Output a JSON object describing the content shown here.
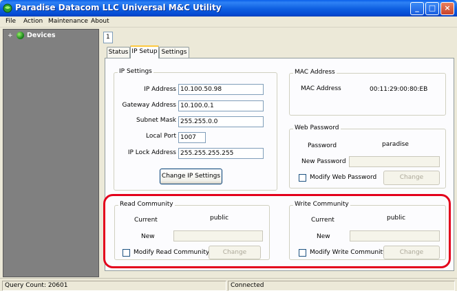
{
  "window": {
    "title": "Paradise Datacom LLC Universal M&C Utility",
    "minimize": "_",
    "maximize": "□",
    "close": "×"
  },
  "menu": [
    "File",
    "Action",
    "Maintenance",
    "About"
  ],
  "tree": {
    "expander": "+",
    "label": "Devices"
  },
  "device_tab": "1",
  "tabs": [
    "Status",
    "IP Setup",
    "Settings"
  ],
  "active_tab": "IP Setup",
  "ip_settings": {
    "title": "IP Settings",
    "ip_address_label": "IP Address",
    "ip_address": "10.100.50.98",
    "gateway_label": "Gateway Address",
    "gateway": "10.100.0.1",
    "subnet_label": "Subnet Mask",
    "subnet": "255.255.0.0",
    "port_label": "Local Port",
    "port": "1007",
    "lock_label": "IP Lock Address",
    "lock": "255.255.255.255",
    "change_button": "Change IP Settings"
  },
  "mac": {
    "title": "MAC Address",
    "label": "MAC Address",
    "value": "00:11:29:00:80:EB"
  },
  "web_password": {
    "title": "Web Password",
    "password_label": "Password",
    "password": "paradise",
    "new_label": "New Password",
    "new_value": "",
    "modify_label": "Modify Web Password",
    "change_button": "Change"
  },
  "read_community": {
    "title": "Read Community",
    "current_label": "Current",
    "current": "public",
    "new_label": "New",
    "new_value": "",
    "modify_label": "Modify Read Community",
    "change_button": "Change"
  },
  "write_community": {
    "title": "Write Community",
    "current_label": "Current",
    "current": "public",
    "new_label": "New",
    "new_value": "",
    "modify_label": "Modify Write Community",
    "change_button": "Change"
  },
  "status": {
    "query_count": "Query Count: 20601",
    "connection": "Connected"
  },
  "colors": {
    "title_bar": "#0A5FEA",
    "highlight": "#E3001B",
    "tree_background": "#808080"
  }
}
